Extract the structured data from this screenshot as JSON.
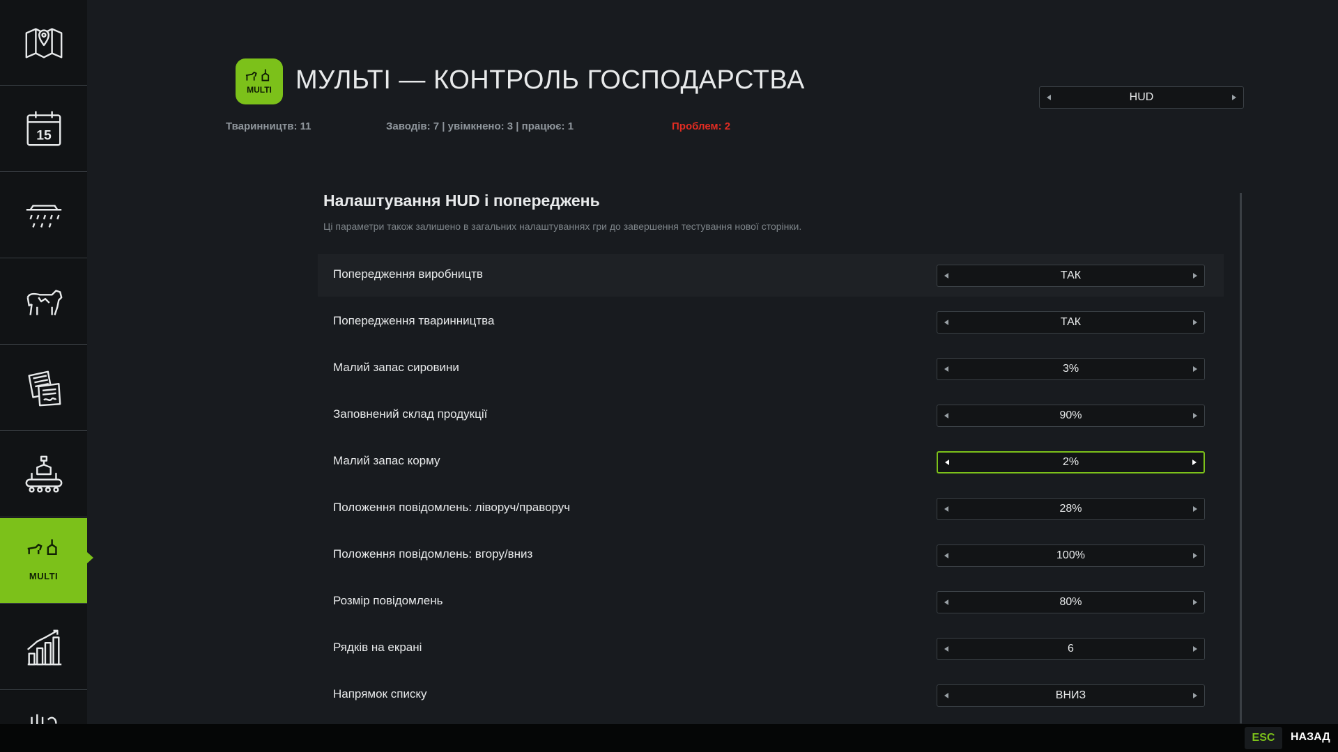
{
  "sidebar": {
    "items": [
      {
        "id": "map",
        "icon": "map-icon"
      },
      {
        "id": "calendar",
        "icon": "calendar-icon",
        "date": "15"
      },
      {
        "id": "weather",
        "icon": "weather-icon"
      },
      {
        "id": "animals",
        "icon": "cow-icon"
      },
      {
        "id": "contracts",
        "icon": "contracts-icon"
      },
      {
        "id": "production",
        "icon": "production-icon"
      },
      {
        "id": "multi",
        "icon": "multi-icon",
        "label": "MULTI",
        "active": true
      },
      {
        "id": "statistics",
        "icon": "statistics-icon"
      },
      {
        "id": "extra",
        "icon": "partial-icon"
      }
    ]
  },
  "header": {
    "logo_label": "MULTI",
    "title": "МУЛЬТІ — КОНТРОЛЬ ГОСПОДАРСТВА",
    "stats": {
      "livestock": "Тваринництв: 11",
      "factories": "Заводів: 7 | увімкнено: 3 | працює: 1",
      "problems": "Проблем: 2"
    },
    "page_selector": "HUD"
  },
  "panel": {
    "title": "Налаштування HUD і попереджень",
    "description": "Ці параметри також залишено в загальних налаштуваннях гри до завершення тестування нової сторінки.",
    "settings": [
      {
        "label": "Попередження виробництв",
        "value": "ТАК"
      },
      {
        "label": "Попередження тваринництва",
        "value": "ТАК"
      },
      {
        "label": "Малий запас сировини",
        "value": "3%"
      },
      {
        "label": "Заповнений склад продукції",
        "value": "90%"
      },
      {
        "label": "Малий запас корму",
        "value": "2%"
      },
      {
        "label": "Положення повідомлень: ліворуч/праворуч",
        "value": "28%"
      },
      {
        "label": "Положення повідомлень: вгору/вниз",
        "value": "100%"
      },
      {
        "label": "Розмір повідомлень",
        "value": "80%"
      },
      {
        "label": "Рядків на екрані",
        "value": "6"
      },
      {
        "label": "Напрямок списку",
        "value": "ВНИЗ"
      }
    ]
  },
  "footer": {
    "esc_key": "ESC",
    "back_label": "НАЗАД"
  },
  "colors": {
    "accent": "#7cc11a",
    "problem": "#e22c22",
    "background": "#181b1f",
    "sidebar": "#0f1113"
  }
}
